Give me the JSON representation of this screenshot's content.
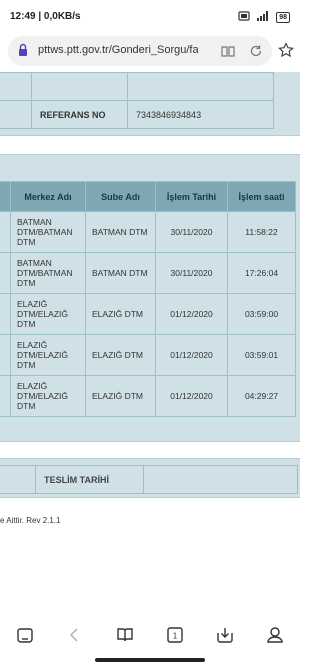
{
  "status_bar": {
    "time_speed": "12:49 | 0,0KB/s",
    "icons": [
      "nfc-icon",
      "signal-icon",
      "battery-icon"
    ],
    "battery_level": "98"
  },
  "url_bar": {
    "url": "pttws.ptt.gov.tr/Gonderi_Sorgu/fac",
    "icons": [
      "lock-icon",
      "reader-mode-icon",
      "reload-icon",
      "bookmark-star-icon"
    ]
  },
  "referans": {
    "label": "REFERANS NO",
    "value": "7343846934843"
  },
  "movements": {
    "columns": [
      "Merkez Adı",
      "Sube Adı",
      "İşlem Tarihi",
      "İşlem saati"
    ],
    "rows": [
      {
        "merkez": "BATMAN DTM/BATMAN DTM",
        "sube": "BATMAN DTM",
        "tarih": "30/11/2020",
        "saat": "11:58:22"
      },
      {
        "merkez": "BATMAN DTM/BATMAN DTM",
        "sube": "BATMAN DTM",
        "tarih": "30/11/2020",
        "saat": "17:26:04"
      },
      {
        "merkez": "ELAZIĞ DTM/ELAZIĞ DTM",
        "sube": "ELAZIĞ DTM",
        "tarih": "01/12/2020",
        "saat": "03:59:00"
      },
      {
        "merkez": "ELAZIĞ DTM/ELAZIĞ DTM",
        "sube": "ELAZIĞ DTM",
        "tarih": "01/12/2020",
        "saat": "03:59:01"
      },
      {
        "merkez": "ELAZIĞ DTM/ELAZIĞ DTM",
        "sube": "ELAZIĞ DTM",
        "tarih": "01/12/2020",
        "saat": "04:29:27"
      }
    ]
  },
  "teslim": {
    "label": "TESLİM TARİHİ",
    "value": ""
  },
  "footer": {
    "note": "e Aittir. Rev 2.1.1"
  },
  "nav_bar": {
    "tab_count": "1",
    "icons": [
      "home-icon",
      "back-icon",
      "book-icon",
      "tabs-icon",
      "download-icon",
      "profile-icon"
    ]
  },
  "colors": {
    "panel_bg": "#cfe1e6",
    "header_bg": "#7da7b2",
    "border": "#9fbfc6"
  }
}
